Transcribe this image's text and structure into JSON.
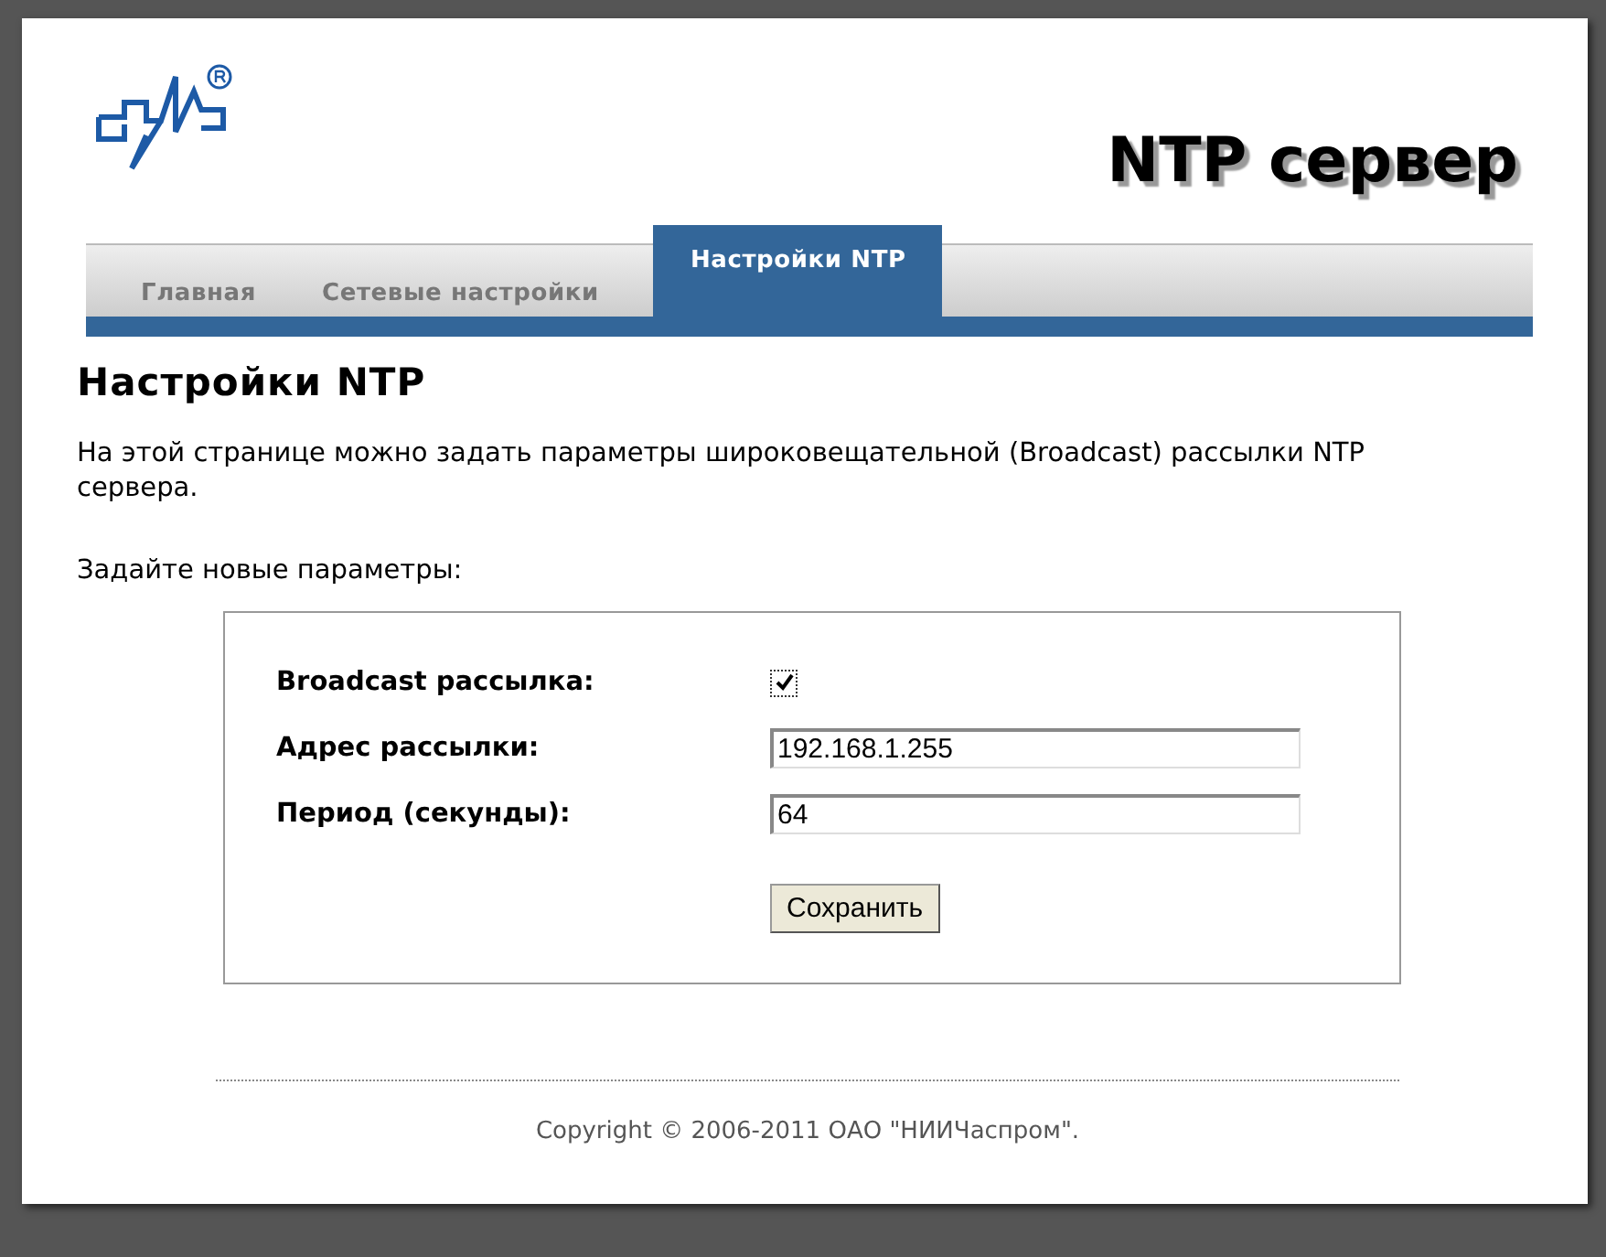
{
  "header": {
    "title": "NTP сервер"
  },
  "tabs": [
    {
      "label": "Главная",
      "selected": false
    },
    {
      "label": "Сетевые настройки",
      "selected": false
    },
    {
      "label": "Настройки NTP",
      "selected": true
    }
  ],
  "page": {
    "heading": "Настройки NTP",
    "description": "На этой странице можно задать параметры широковещательной (Broadcast) рассылки NTP сервера.",
    "prompt": "Задайте новые параметры:"
  },
  "form": {
    "fields": [
      {
        "kind": "checkbox",
        "label": "Broadcast рассылка:",
        "checked": true
      },
      {
        "kind": "text",
        "label": "Адрес рассылки:",
        "value": "192.168.1.255"
      },
      {
        "kind": "text",
        "label": "Период (секунды):",
        "value": "64"
      }
    ],
    "button": "Сохранить"
  },
  "footer": {
    "copyright": "Copyright © 2006-2011 ОАО \"НИИЧаспром\"."
  }
}
